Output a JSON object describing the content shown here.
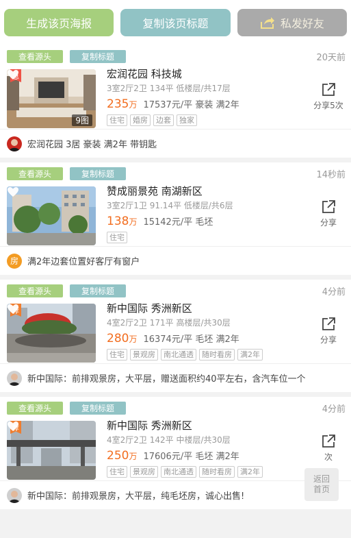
{
  "toolbar": {
    "generate_poster": "生成该页海报",
    "copy_title": "复制该页标题",
    "send_friend": "私发好友"
  },
  "common": {
    "view_source": "查看源头",
    "copy_title": "复制标题"
  },
  "listings": [
    {
      "time": "20天前",
      "badge": "急",
      "image_count": "9图",
      "title": "宏润花园 科技城",
      "specs": "3室2厅2卫 134平 低楼层/共17层",
      "price": "235",
      "price_unit": "万",
      "price_detail": "17537元/平 豪装 满2年",
      "labels": [
        "住宅",
        "婚房",
        "边套",
        "独家"
      ],
      "share": "分享5次",
      "description": "宏润花园 3居 豪装 满2年 带钥匙"
    },
    {
      "time": "14秒前",
      "badge": "",
      "image_count": "",
      "title": "赞成丽景苑 南湖新区",
      "specs": "3室2厅1卫 91.14平 低楼层/共6层",
      "price": "138",
      "price_unit": "万",
      "price_detail": "15142元/平 毛坯",
      "labels": [
        "住宅"
      ],
      "share": "分享",
      "avatar_text": "房",
      "description": "满2年边套位置好客厅有窗户"
    },
    {
      "time": "4分前",
      "badge": "荐",
      "image_count": "",
      "title": "新中国际 秀洲新区",
      "specs": "4室2厅2卫 171平 高楼层/共30层",
      "price": "280",
      "price_unit": "万",
      "price_detail": "16374元/平 毛坯 满2年",
      "labels": [
        "住宅",
        "景观房",
        "南北通透",
        "随时看房",
        "满2年"
      ],
      "share": "分享",
      "description": "新中国际：前排观景房，大平层，赠送面积约40平左右，含汽车位一个"
    },
    {
      "time": "4分前",
      "badge": "荐",
      "image_count": "",
      "title": "新中国际 秀洲新区",
      "specs": "4室2厅2卫 142平 中楼层/共30层",
      "price": "250",
      "price_unit": "万",
      "price_detail": "17606元/平 毛坯 满2年",
      "labels": [
        "住宅",
        "景观房",
        "南北通透",
        "随时看房",
        "满2年"
      ],
      "share": "次",
      "description": "新中国际：前排观景房，大平层，纯毛坯房，诚心出售!"
    }
  ],
  "back_home": {
    "line1": "返回",
    "line2": "首页"
  },
  "colors": {
    "accent_green": "#a6cf7d",
    "accent_teal": "#91c3c5",
    "price_orange": "#f26d1f",
    "urgent_red": "#ef5246"
  }
}
